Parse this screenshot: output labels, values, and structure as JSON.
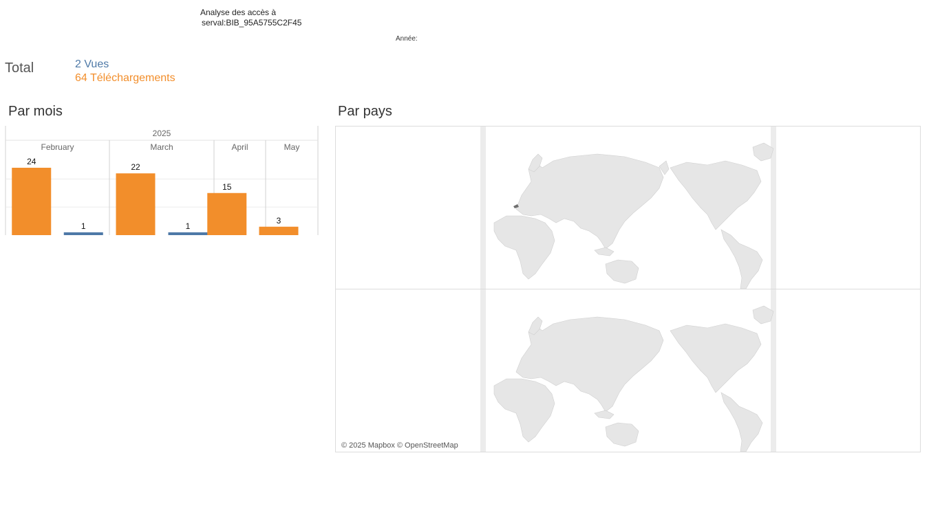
{
  "title": {
    "line1": "Analyse des accès à",
    "line2": "serval:BIB_95A5755C2F45"
  },
  "filter": {
    "year_label": "Année:"
  },
  "total": {
    "label": "Total",
    "views": "2 Vues",
    "downloads": "64 Téléchargements"
  },
  "sections": {
    "monthly": "Par mois",
    "country": "Par pays"
  },
  "map": {
    "attribution": "© 2025 Mapbox © OpenStreetMap",
    "highlighted_country": "Switzerland"
  },
  "colors": {
    "views": "#4e79a7",
    "downloads": "#f28e2b",
    "land": "#e6e6e6",
    "highlight": "#6f6f6f"
  },
  "chart_data": {
    "type": "bar",
    "year": "2025",
    "categories": [
      "February",
      "March",
      "April",
      "May"
    ],
    "series": [
      {
        "name": "Téléchargements",
        "values": [
          24,
          22,
          15,
          3
        ]
      },
      {
        "name": "Vues",
        "values": [
          1,
          1,
          null,
          null
        ]
      }
    ],
    "ylim": [
      0,
      24
    ],
    "grid": true
  }
}
